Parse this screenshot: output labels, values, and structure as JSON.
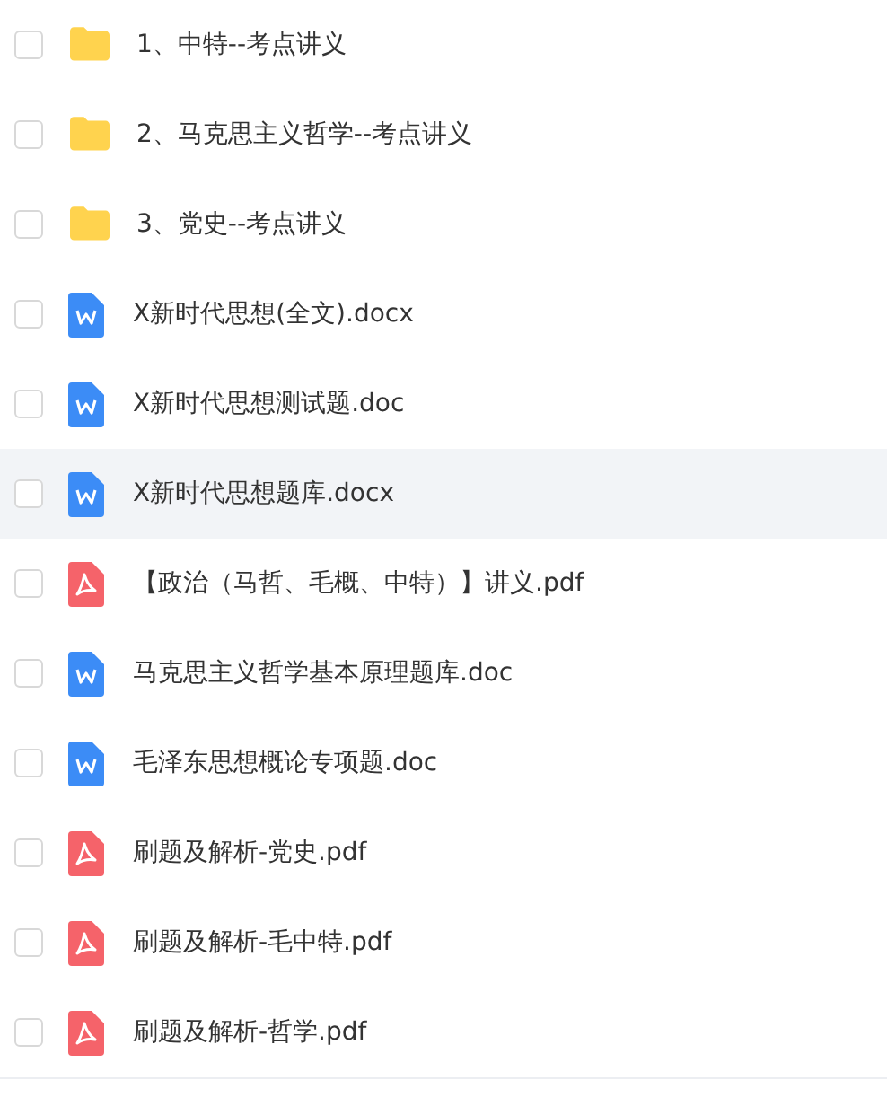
{
  "files": [
    {
      "kind": "folder",
      "name": "1、中特--考点讲义",
      "checked": false,
      "highlighted": false
    },
    {
      "kind": "folder",
      "name": "2、马克思主义哲学--考点讲义",
      "checked": false,
      "highlighted": false
    },
    {
      "kind": "folder",
      "name": "3、党史--考点讲义",
      "checked": false,
      "highlighted": false
    },
    {
      "kind": "word",
      "name": "X新时代思想(全文).docx",
      "checked": false,
      "highlighted": false
    },
    {
      "kind": "word",
      "name": "X新时代思想测试题.doc",
      "checked": false,
      "highlighted": false
    },
    {
      "kind": "word",
      "name": "X新时代思想题库.docx",
      "checked": false,
      "highlighted": true
    },
    {
      "kind": "pdf",
      "name": "【政治（马哲、毛概、中特）】讲义.pdf",
      "checked": false,
      "highlighted": false
    },
    {
      "kind": "word",
      "name": "马克思主义哲学基本原理题库.doc",
      "checked": false,
      "highlighted": false
    },
    {
      "kind": "word",
      "name": "毛泽东思想概论专项题.doc",
      "checked": false,
      "highlighted": false
    },
    {
      "kind": "pdf",
      "name": "刷题及解析-党史.pdf",
      "checked": false,
      "highlighted": false
    },
    {
      "kind": "pdf",
      "name": "刷题及解析-毛中特.pdf",
      "checked": false,
      "highlighted": false
    },
    {
      "kind": "pdf",
      "name": "刷题及解析-哲学.pdf",
      "checked": false,
      "highlighted": false
    }
  ]
}
